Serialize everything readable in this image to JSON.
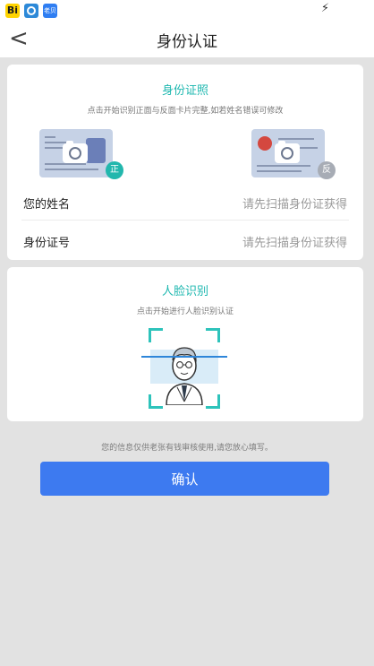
{
  "status_bar": {
    "apps": [
      {
        "label": "Bi",
        "icon": "bilibili-app-icon"
      },
      {
        "label": "",
        "icon": "browser-app-icon"
      },
      {
        "label": "老贝",
        "icon": "app-badge-icon"
      }
    ],
    "charging_icon": "charging-bolt-icon"
  },
  "nav": {
    "back_label": "<",
    "title": "身份认证"
  },
  "id_section": {
    "title": "身份证照",
    "subtitle": "点击开始识别正面与反面卡片完整,如若姓名错误可修改",
    "front_badge": "正",
    "back_badge": "反",
    "rows": [
      {
        "label": "您的姓名",
        "value": "请先扫描身份证获得"
      },
      {
        "label": "身份证号",
        "value": "请先扫描身份证获得"
      }
    ]
  },
  "face_section": {
    "title": "人脸识别",
    "subtitle": "点击开始进行人脸识别认证"
  },
  "notice": "您的信息仅供老张有钱审核使用,请您放心填写。",
  "confirm_label": "确认",
  "colors": {
    "accent": "#1fb8b0",
    "button": "#3d7af0",
    "background": "#e2e2e2"
  }
}
